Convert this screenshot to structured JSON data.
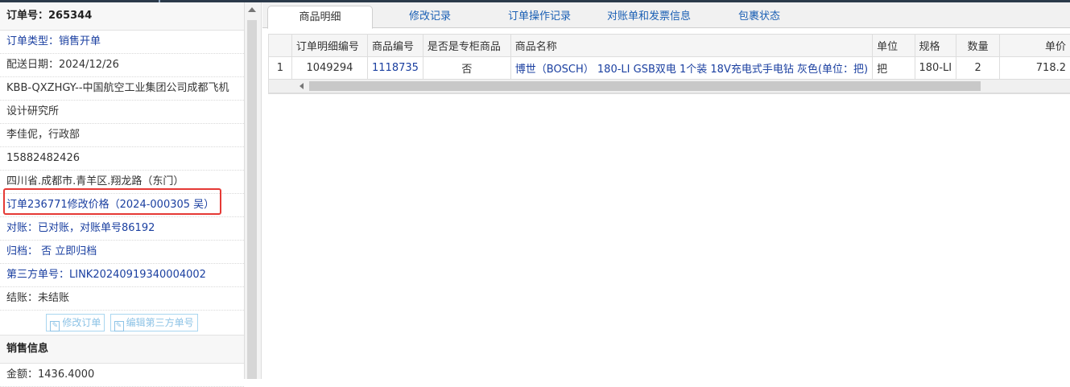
{
  "left": {
    "order_no": "订单号：265344",
    "rows": [
      {
        "text": "订单类型：销售开单",
        "blue": true
      },
      {
        "text": "配送日期：2024/12/26",
        "blue": false
      },
      {
        "text": "KBB-QXZHGY--中国航空工业集团公司成都飞机",
        "blue": false
      },
      {
        "text": "设计研究所",
        "blue": false
      },
      {
        "text": "李佳伲，行政部",
        "blue": false
      },
      {
        "text": "15882482426",
        "blue": false
      },
      {
        "text": "四川省.成都市.青羊区.翔龙路（东门）",
        "blue": false
      },
      {
        "text": "订单236771修改价格（2024-000305 吴）",
        "blue": true
      },
      {
        "text": "对账：已对账，对账单号86192",
        "blue": true
      },
      {
        "text": "归档： 否 立即归档",
        "blue": true
      },
      {
        "text": "第三方单号：LINK20240919340004002",
        "blue": true
      },
      {
        "text": "结账：未结账",
        "blue": false
      }
    ],
    "buttons": {
      "edit_order": "修改订单",
      "edit_third_party": "编辑第三方单号"
    },
    "sales_section": "销售信息",
    "amount": "金额：1436.4000"
  },
  "tabs": [
    "商品明细",
    "修改记录",
    "订单操作记录",
    "对账单和发票信息",
    "包裹状态"
  ],
  "table": {
    "headers": [
      "",
      "订单明细编号",
      "商品编号",
      "是否是专柜商品",
      "商品名称",
      "单位",
      "规格",
      "数量",
      "单价"
    ],
    "rows": [
      [
        "1",
        "1049294",
        "1118735",
        "否",
        "博世（BOSCH） 180-LI GSB双电 1个装 18V充电式手电钻 灰色(单位：把)",
        "把",
        "180-LI",
        "2",
        "718.2"
      ]
    ]
  },
  "colors": {
    "link": "#1a3fa0",
    "highlight_box": "#e53935",
    "tab_text": "#1a5fb4"
  },
  "icons": {
    "button_icon": "edit-icon"
  }
}
